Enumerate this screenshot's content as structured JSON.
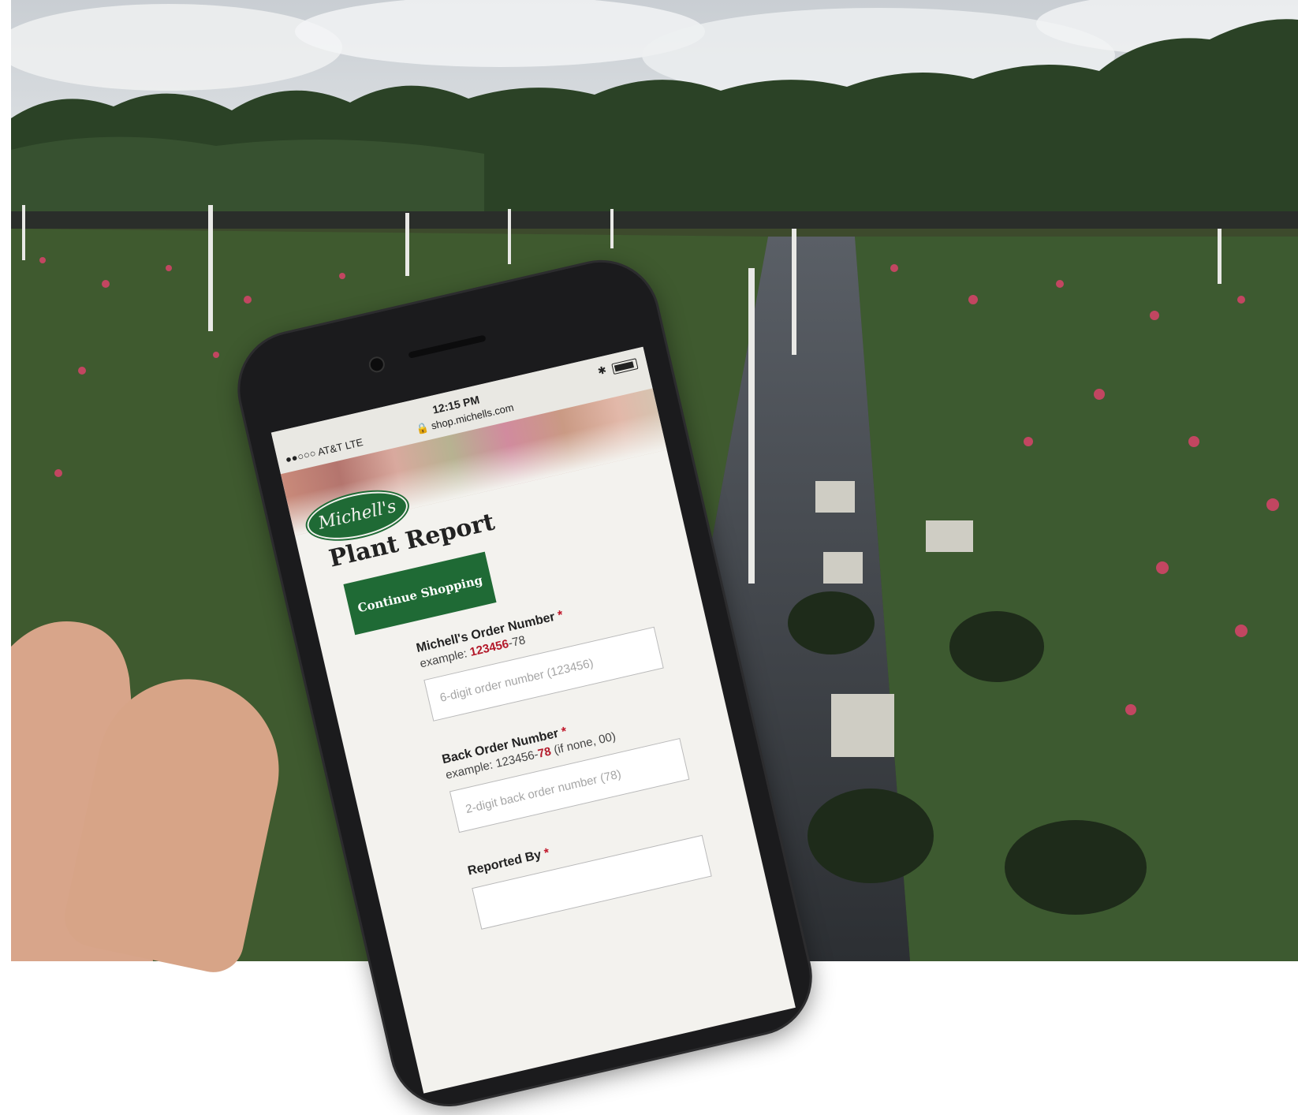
{
  "phone": {
    "status": {
      "carrier": "●●○○○ AT&T  LTE",
      "time": "12:15 PM",
      "url": "🔒 shop.michells.com",
      "bluetooth": "✱"
    },
    "logo_text": "Michell's",
    "page_title": "Plant Report",
    "cta_label": "Continue Shopping",
    "form": {
      "order": {
        "label": "Michell's Order Number",
        "required": "*",
        "example_prefix": "example: ",
        "example_highlight": "123456",
        "example_suffix": "-78",
        "placeholder": "6-digit order number (123456)"
      },
      "back_order": {
        "label": "Back Order Number",
        "required": "*",
        "example_prefix": "example: 123456-",
        "example_highlight": "78",
        "example_suffix": " (if none, 00)",
        "placeholder": "2-digit back order number (78)"
      },
      "reported_by": {
        "label": "Reported By",
        "required": "*"
      }
    }
  },
  "colors": {
    "brand_green": "#1f6a35",
    "highlight_red": "#b3192a"
  }
}
